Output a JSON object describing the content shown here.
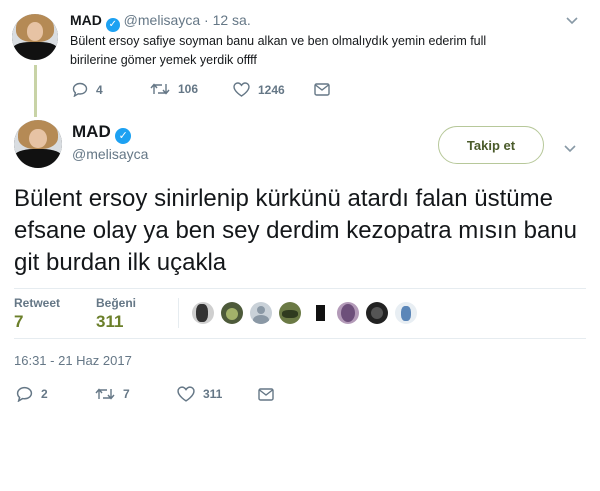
{
  "reply_tweet": {
    "name": "MAD",
    "handle": "@melisayca",
    "separator": "·",
    "time": "12 sa.",
    "text": "Bülent ersoy safiye soyman banu alkan ve ben olmalıydık yemin ederim full birilerine gömer yemek yerdik offff",
    "replies": "4",
    "retweets": "106",
    "likes": "1246"
  },
  "main_tweet": {
    "name": "MAD",
    "handle": "@melisayca",
    "follow_label": "Takip et",
    "text": "Bülent ersoy sinirlenip kürkünü atardı falan üstüme efsane olay ya ben sey derdim kezopatra mısın banu git burdan ilk uçakla",
    "stats": {
      "retweet_label": "Retweet",
      "retweet_count": "7",
      "like_label": "Beğeni",
      "like_count": "311"
    },
    "timestamp": "16:31 - 21 Haz 2017",
    "actions": {
      "replies": "2",
      "retweets": "7",
      "likes": "311"
    }
  },
  "icons": {
    "verified": "verified-badge-icon",
    "reply": "reply-icon",
    "retweet": "retweet-icon",
    "like": "heart-icon",
    "dm": "envelope-icon",
    "menu": "chevron-down-icon"
  },
  "colors": {
    "verified": "#1da1f2",
    "accent": "#6b7f2a",
    "muted": "#657786"
  }
}
